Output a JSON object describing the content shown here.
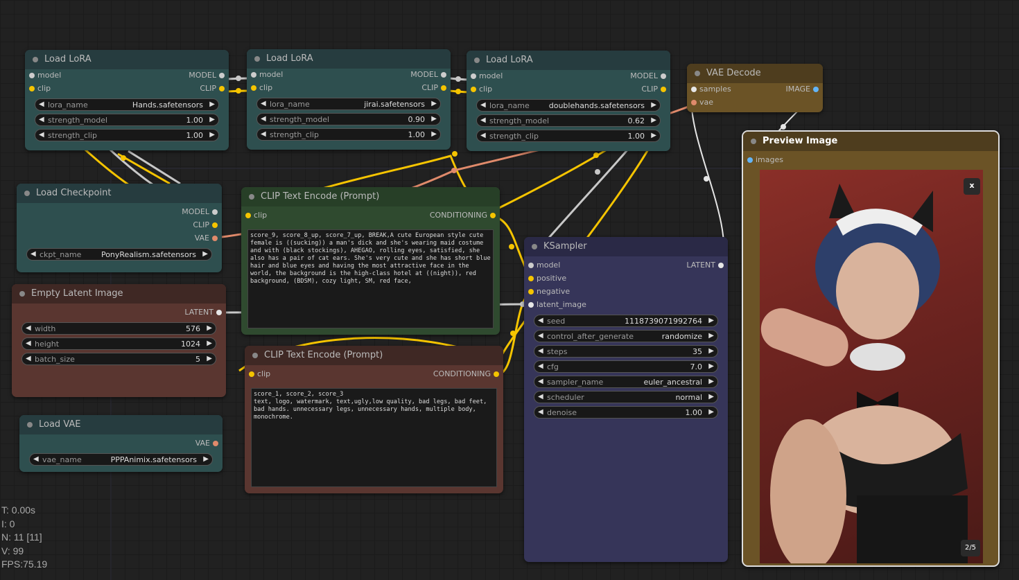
{
  "nodes": {
    "lora1": {
      "title": "Load LoRA",
      "inputs": [
        "model",
        "clip"
      ],
      "outputs": [
        "MODEL",
        "CLIP"
      ],
      "widgets": [
        {
          "label": "lora_name",
          "value": "Hands.safetensors"
        },
        {
          "label": "strength_model",
          "value": "1.00"
        },
        {
          "label": "strength_clip",
          "value": "1.00"
        }
      ]
    },
    "lora2": {
      "title": "Load LoRA",
      "inputs": [
        "model",
        "clip"
      ],
      "outputs": [
        "MODEL",
        "CLIP"
      ],
      "widgets": [
        {
          "label": "lora_name",
          "value": "jirai.safetensors"
        },
        {
          "label": "strength_model",
          "value": "0.90"
        },
        {
          "label": "strength_clip",
          "value": "1.00"
        }
      ]
    },
    "lora3": {
      "title": "Load LoRA",
      "inputs": [
        "model",
        "clip"
      ],
      "outputs": [
        "MODEL",
        "CLIP"
      ],
      "widgets": [
        {
          "label": "lora_name",
          "value": "doublehands.safetensors"
        },
        {
          "label": "strength_model",
          "value": "0.62"
        },
        {
          "label": "strength_clip",
          "value": "1.00"
        }
      ]
    },
    "vae_decode": {
      "title": "VAE Decode",
      "inputs": [
        "samples",
        "vae"
      ],
      "outputs": [
        "IMAGE"
      ]
    },
    "checkpoint": {
      "title": "Load Checkpoint",
      "outputs": [
        "MODEL",
        "CLIP",
        "VAE"
      ],
      "widgets": [
        {
          "label": "ckpt_name",
          "value": "PonyRealism.safetensors"
        }
      ]
    },
    "clip_pos": {
      "title": "CLIP Text Encode (Prompt)",
      "inputs": [
        "clip"
      ],
      "outputs": [
        "CONDITIONING"
      ],
      "text": "score_9, score_8_up, score_7_up, BREAK,A cute European style cute female is ((sucking)) a man's dick and she's wearing maid costume and with (black stockings), AHEGAO, rolling eyes, satisfied, she also has a pair of cat ears. She's very cute and she has short blue hair and blue eyes and having the most attractive face in the world, the background is the high-class hotel at ((night)), red background, (BDSM), cozy light, SM, red face,"
    },
    "clip_neg": {
      "title": "CLIP Text Encode (Prompt)",
      "inputs": [
        "clip"
      ],
      "outputs": [
        "CONDITIONING"
      ],
      "text": "score_1, score_2, score_3\ntext, logo, watermark, text,ugly,low quality, bad legs, bad feet, bad hands. unnecessary legs, unnecessary hands, multiple body, monochrome."
    },
    "empty_latent": {
      "title": "Empty Latent Image",
      "outputs": [
        "LATENT"
      ],
      "widgets": [
        {
          "label": "width",
          "value": "576"
        },
        {
          "label": "height",
          "value": "1024"
        },
        {
          "label": "batch_size",
          "value": "5"
        }
      ]
    },
    "load_vae": {
      "title": "Load VAE",
      "outputs": [
        "VAE"
      ],
      "widgets": [
        {
          "label": "vae_name",
          "value": "PPPAnimix.safetensors"
        }
      ]
    },
    "ksampler": {
      "title": "KSampler",
      "inputs": [
        "model",
        "positive",
        "negative",
        "latent_image"
      ],
      "outputs": [
        "LATENT"
      ],
      "widgets": [
        {
          "label": "seed",
          "value": "1118739071992764"
        },
        {
          "label": "control_after_generate",
          "value": "randomize"
        },
        {
          "label": "steps",
          "value": "35"
        },
        {
          "label": "cfg",
          "value": "7.0"
        },
        {
          "label": "sampler_name",
          "value": "euler_ancestral"
        },
        {
          "label": "scheduler",
          "value": "normal"
        },
        {
          "label": "denoise",
          "value": "1.00"
        }
      ]
    },
    "preview": {
      "title": "Preview Image",
      "inputs": [
        "images"
      ],
      "close_label": "x",
      "counter": "2/5"
    }
  },
  "stats": [
    "T: 0.00s",
    "I: 0",
    "N: 11 [11]",
    "V: 99",
    "FPS:75.19"
  ],
  "colors": {
    "canvas": "#212121",
    "clip_wire": "#f5c400",
    "model_wire": "#c8c8c8",
    "vae_wire": "#e08a6b",
    "image_slot": "#64b5f6"
  }
}
